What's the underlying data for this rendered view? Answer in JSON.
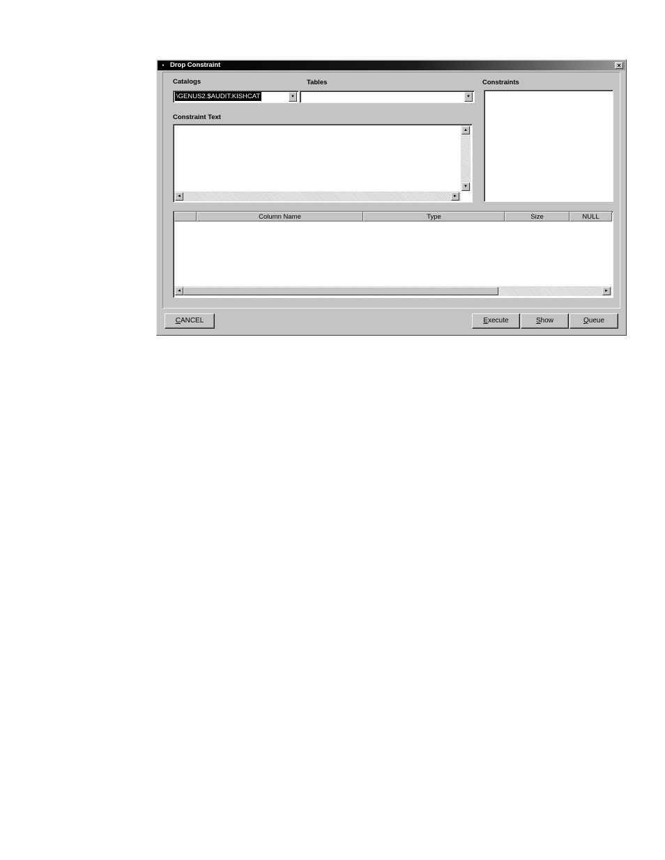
{
  "window": {
    "title": "Drop Constraint",
    "close_glyph": "×"
  },
  "catalogs": {
    "label": "Catalogs",
    "selected_value": "\\GENUS2.$AUDIT.KISHCAT"
  },
  "tables": {
    "label": "Tables",
    "selected_value": ""
  },
  "constraints": {
    "label": "Constraints",
    "items": []
  },
  "constraint_text": {
    "label": "Constraint Text",
    "value": ""
  },
  "grid": {
    "columns": [
      "",
      "Column Name",
      "Type",
      "Size",
      "NULL"
    ],
    "rows": []
  },
  "buttons": {
    "cancel": {
      "mnemonic": "C",
      "rest": "ANCEL"
    },
    "execute": {
      "mnemonic": "E",
      "rest": "xecute"
    },
    "show": {
      "mnemonic": "S",
      "rest": "how"
    },
    "queue": {
      "mnemonic": "Q",
      "rest": "ueue"
    }
  },
  "icons": {
    "dropdown": "▼",
    "arrow_up": "▲",
    "arrow_down": "▼",
    "arrow_left": "◄",
    "arrow_right": "►"
  }
}
